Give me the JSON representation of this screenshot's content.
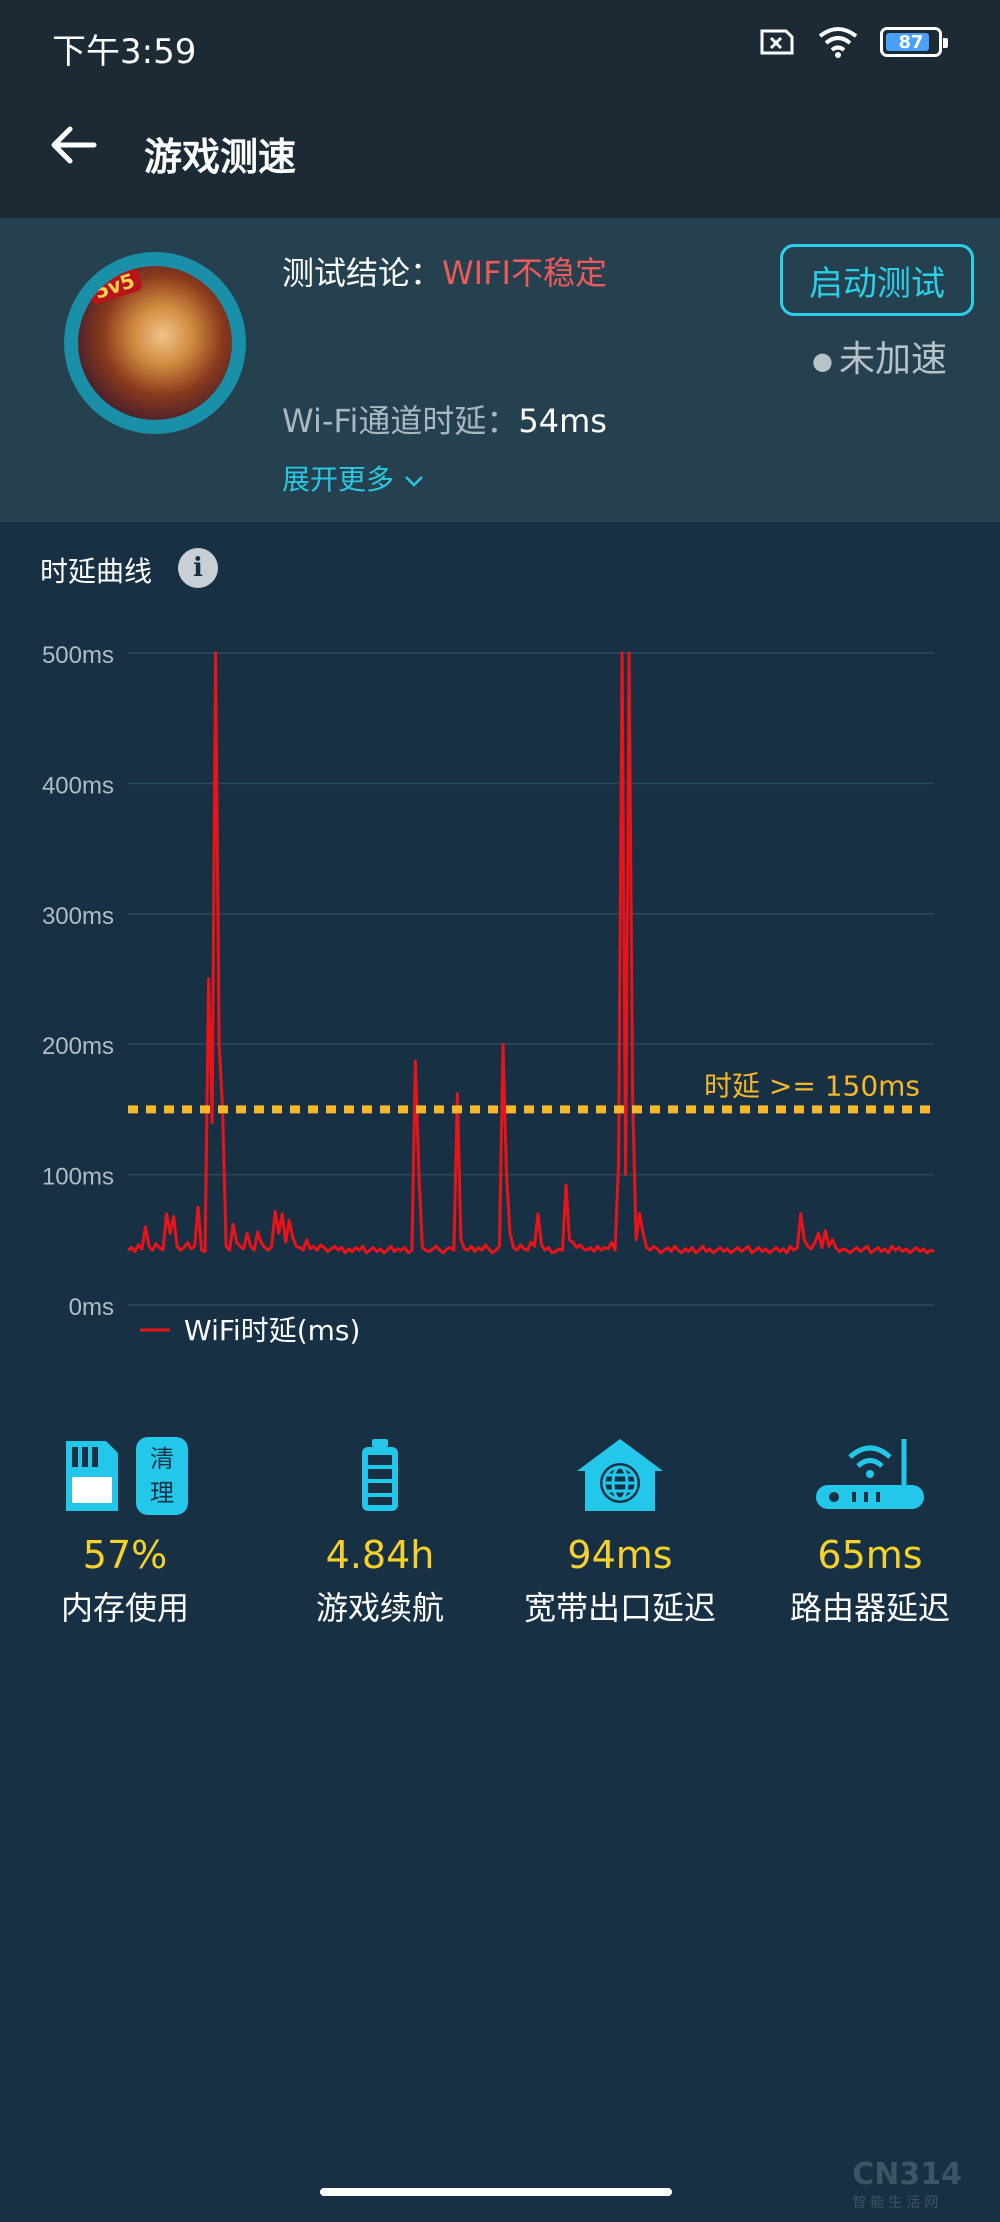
{
  "status_bar": {
    "time": "下午3:59",
    "battery": "87",
    "battery_level": 0.87,
    "icons": [
      "sim-off-icon",
      "wifi-icon",
      "battery-icon"
    ]
  },
  "app_bar": {
    "title": "游戏测速",
    "back_icon": "arrow-left-icon"
  },
  "summary": {
    "conclusion_label": "测试结论：",
    "conclusion_value": "WIFI不稳定",
    "start_button": "启动测试",
    "accel_status": "未加速",
    "latency_label": "Wi-Fi通道时延：",
    "latency_value": "54ms",
    "expand_label": "展开更多",
    "avatar_badge": "5v5"
  },
  "chart_section": {
    "title": "时延曲线",
    "info_icon": "info-icon"
  },
  "chart_data": {
    "type": "line",
    "ylim": [
      0,
      500
    ],
    "y_ticks": [
      "0ms",
      "100ms",
      "200ms",
      "300ms",
      "400ms",
      "500ms"
    ],
    "y_tick_values": [
      0,
      100,
      200,
      300,
      400,
      500
    ],
    "threshold": {
      "value": 150,
      "label": "时延 >= 150ms",
      "color": "#f5b828"
    },
    "series": [
      {
        "name": "WiFi时延(ms)",
        "color": "#e8141a",
        "values": [
          42,
          44,
          41,
          46,
          43,
          60,
          45,
          42,
          47,
          44,
          42,
          70,
          55,
          68,
          45,
          42,
          44,
          48,
          43,
          45,
          75,
          42,
          41,
          250,
          140,
          500,
          200,
          150,
          45,
          42,
          62,
          48,
          45,
          43,
          55,
          45,
          42,
          56,
          48,
          44,
          42,
          45,
          72,
          55,
          70,
          48,
          65,
          52,
          45,
          44,
          42,
          50,
          43,
          45,
          42,
          46,
          44,
          41,
          43,
          45,
          42,
          44,
          40,
          43,
          41,
          44,
          42,
          45,
          40,
          42,
          44,
          41,
          43,
          40,
          42,
          45,
          41,
          43,
          42,
          44,
          40,
          42,
          187,
          100,
          44,
          42,
          41,
          43,
          45,
          42,
          40,
          43,
          44,
          42,
          162,
          50,
          43,
          42,
          45,
          41,
          44,
          42,
          46,
          43,
          40,
          42,
          45,
          200,
          100,
          55,
          44,
          42,
          46,
          43,
          42,
          48,
          45,
          70,
          46,
          42,
          44,
          40,
          41,
          43,
          42,
          92,
          50,
          48,
          44,
          46,
          43,
          42,
          44,
          41,
          45,
          42,
          44,
          43,
          48,
          42,
          110,
          500,
          100,
          500,
          160,
          50,
          70,
          55,
          44,
          42,
          45,
          43,
          40,
          42,
          44,
          41,
          45,
          42,
          40,
          43,
          41,
          44,
          40,
          42,
          45,
          41,
          43,
          40,
          42,
          44,
          41,
          43,
          40,
          42,
          44,
          41,
          43,
          45,
          40,
          42,
          44,
          41,
          43,
          40,
          42,
          44,
          41,
          43,
          40,
          45,
          42,
          44,
          70,
          50,
          45,
          43,
          48,
          55,
          44,
          57,
          45,
          50,
          44,
          41,
          43,
          42,
          40,
          42,
          44,
          41,
          43,
          45,
          40,
          42,
          44,
          41,
          43,
          40,
          45,
          42,
          44,
          41,
          43,
          40,
          42,
          44,
          41,
          43,
          40,
          42,
          41
        ]
      }
    ],
    "legend_position": "bottom-left",
    "grid": true
  },
  "stats": [
    {
      "value": "57%",
      "label": "内存使用",
      "icon": "sd-card-icon",
      "extra_button": "清理"
    },
    {
      "value": "4.84h",
      "label": "游戏续航",
      "icon": "battery-icon"
    },
    {
      "value": "94ms",
      "label": "宽带出口延迟",
      "icon": "globe-house-icon"
    },
    {
      "value": "65ms",
      "label": "路由器延迟",
      "icon": "router-icon"
    }
  ],
  "watermark": {
    "brand": "CN314",
    "sub": "智能生活网"
  }
}
